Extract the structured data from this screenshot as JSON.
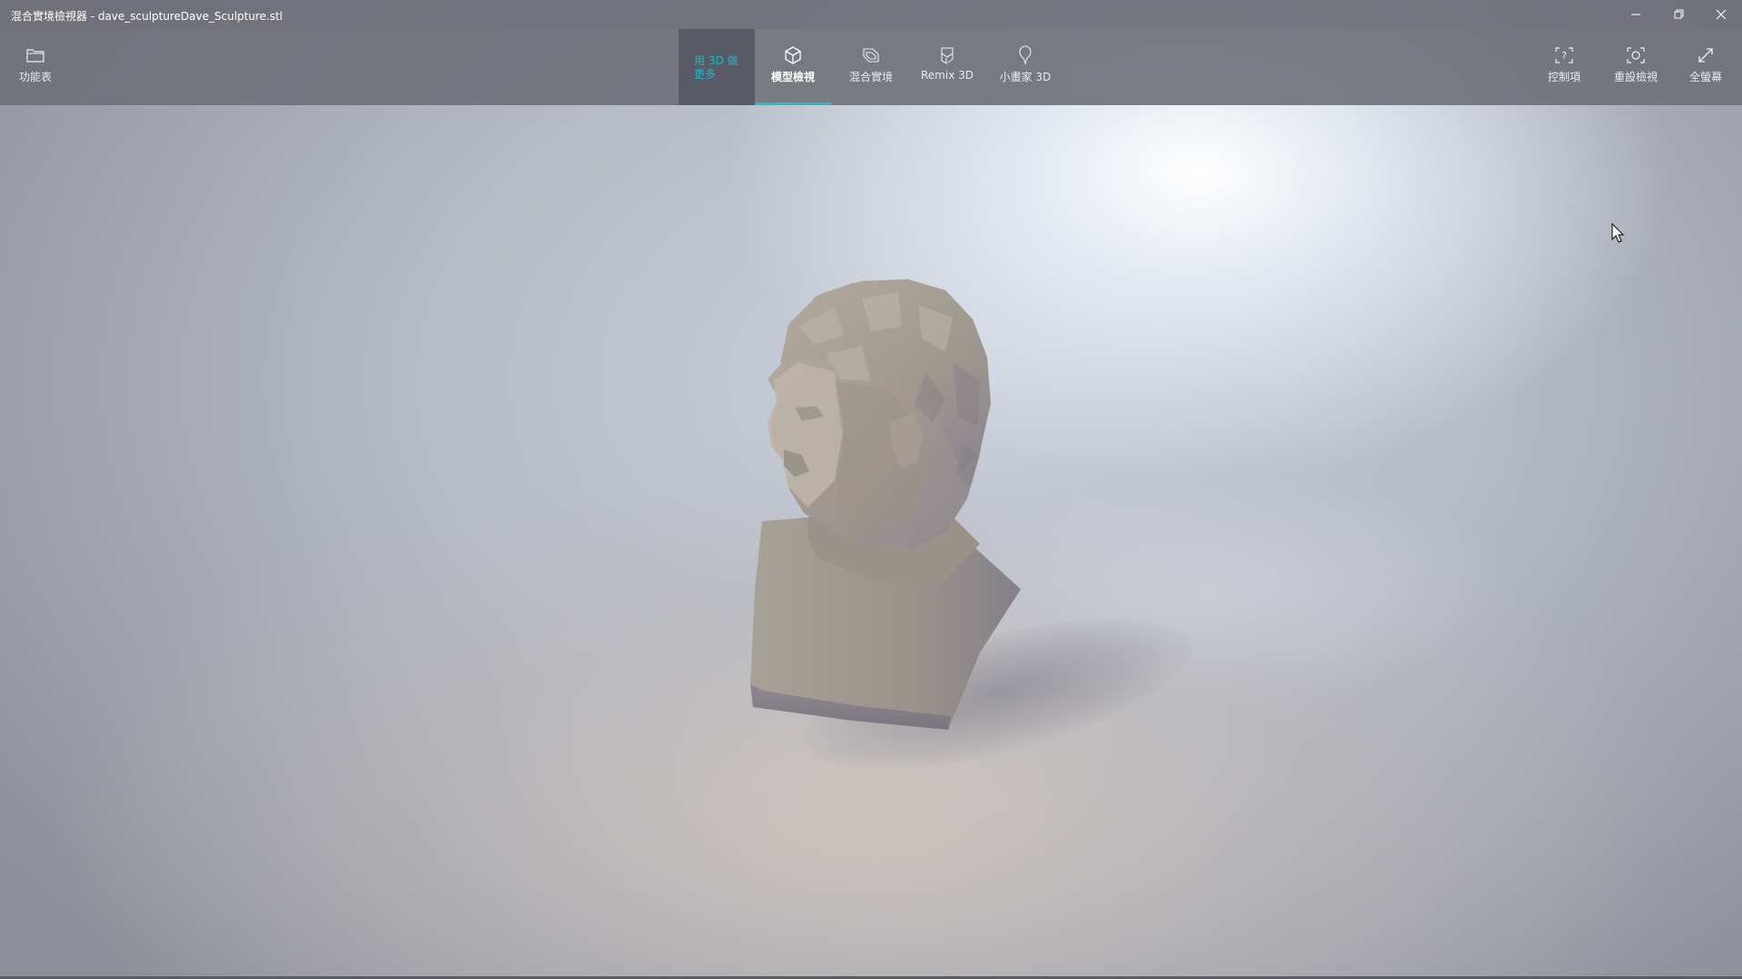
{
  "window": {
    "title": "混合實境檢視器 - dave_sculptureDave_Sculpture.stl",
    "controls": {
      "minimize_icon": "minimize-icon",
      "restore_icon": "restore-icon",
      "close_icon": "close-icon"
    }
  },
  "toolbar": {
    "menu": {
      "label": "功能表",
      "icon": "folder-icon"
    },
    "more3d": {
      "label": "用 3D 做更多"
    },
    "tabs": [
      {
        "label": "模型檢視",
        "icon": "cube-icon",
        "active": true
      },
      {
        "label": "混合實境",
        "icon": "mixed-reality-icon",
        "active": false
      },
      {
        "label": "Remix 3D",
        "icon": "remix3d-icon",
        "active": false
      },
      {
        "label": "小畫家 3D",
        "icon": "paint3d-icon",
        "active": false
      }
    ],
    "right": [
      {
        "label": "控制項",
        "icon": "controls-help-icon"
      },
      {
        "label": "重設檢視",
        "icon": "reset-view-icon"
      },
      {
        "label": "全螢幕",
        "icon": "fullscreen-icon"
      }
    ]
  },
  "colors": {
    "accent": "#27b9cf",
    "toolbar_bg": "#6e7078",
    "model": "#a39b90"
  },
  "viewport": {
    "model_icon": "sculpture-bust-model"
  }
}
